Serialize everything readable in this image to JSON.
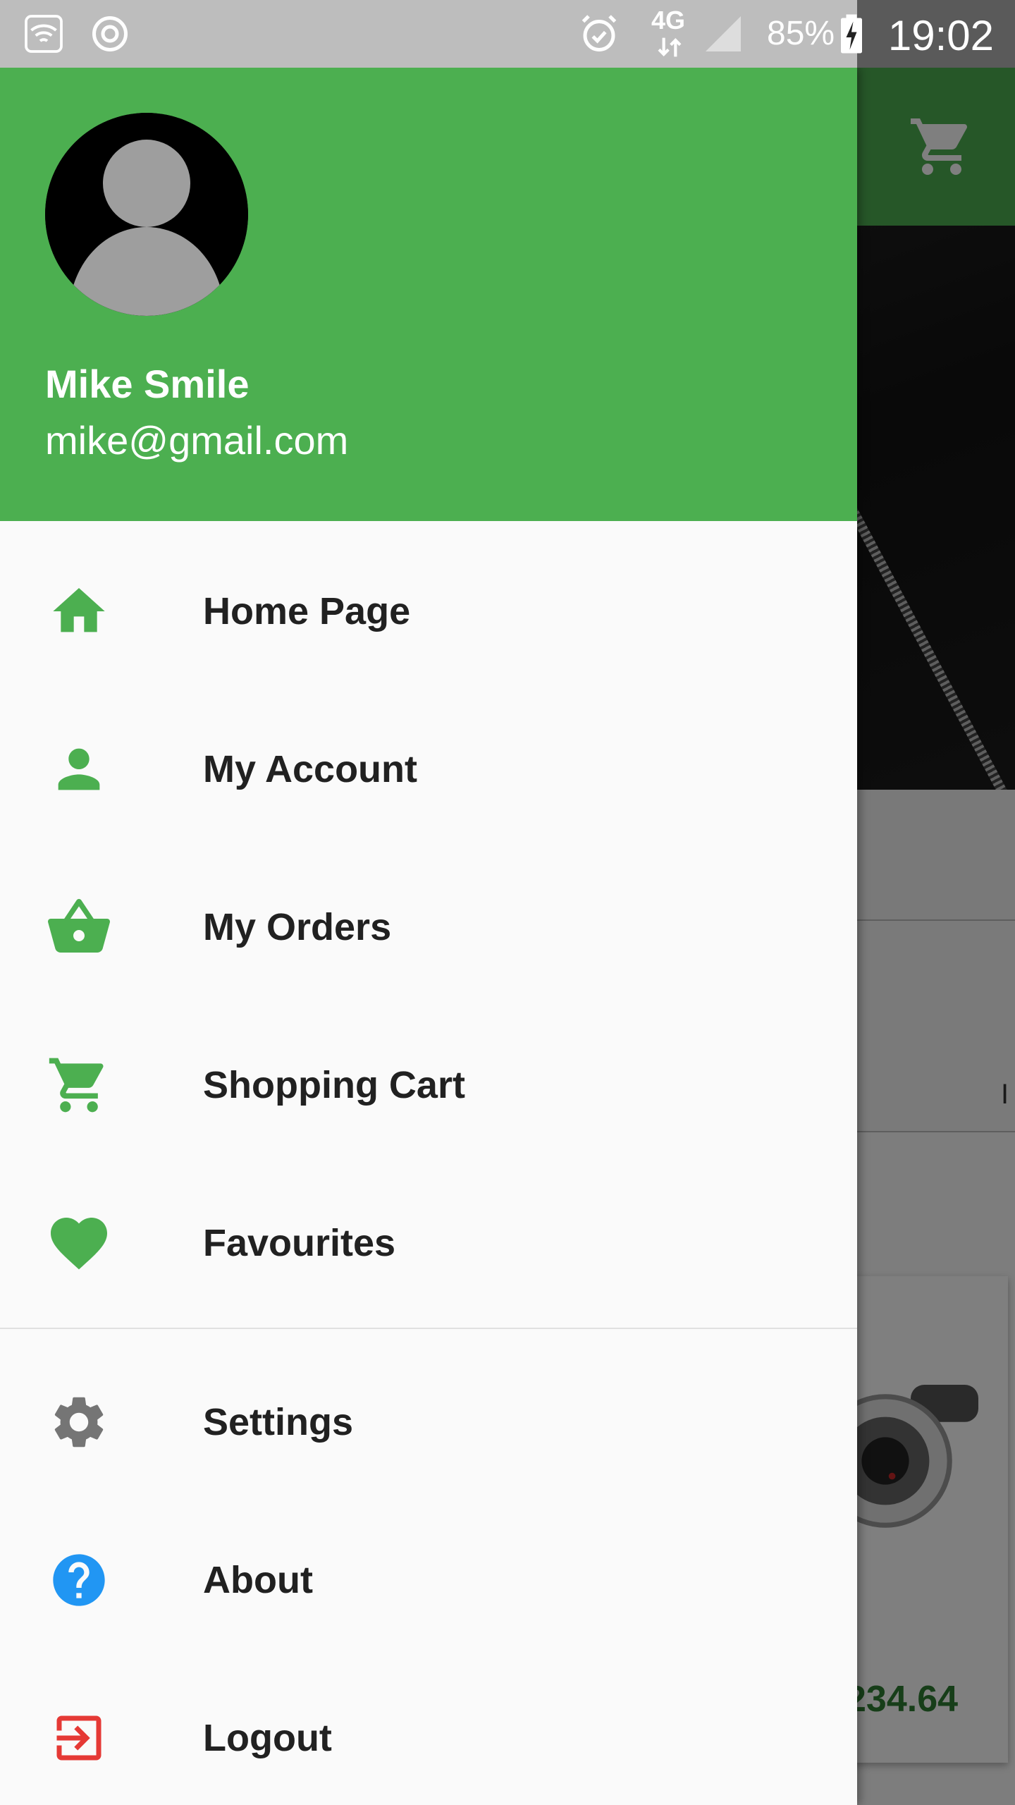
{
  "status_bar": {
    "battery": "85%",
    "network": "4G",
    "time": "19:02",
    "icons": [
      "wifi-icon",
      "sync-icon",
      "alarm-icon",
      "network-4g-icon",
      "signal-icon",
      "battery-charging-icon"
    ]
  },
  "background_app": {
    "price": "234.64",
    "row_text": "I",
    "toolbar_icon": "cart-icon"
  },
  "drawer": {
    "header": {
      "name": "Mike Smile",
      "email": "mike@gmail.com",
      "avatar_icon": "avatar-placeholder-icon"
    },
    "primary_items": [
      {
        "label": "Home Page",
        "icon": "home-icon"
      },
      {
        "label": "My Account",
        "icon": "person-icon"
      },
      {
        "label": "My Orders",
        "icon": "basket-icon"
      },
      {
        "label": "Shopping Cart",
        "icon": "cart-icon"
      },
      {
        "label": "Favourites",
        "icon": "heart-icon"
      }
    ],
    "secondary_items": [
      {
        "label": "Settings",
        "icon": "gear-icon"
      },
      {
        "label": "About",
        "icon": "help-icon"
      },
      {
        "label": "Logout",
        "icon": "logout-icon"
      }
    ]
  },
  "colors": {
    "primary": "#4caf50",
    "primary_dark": "#2e7d32",
    "icon_gray": "#757575",
    "about_blue": "#2196f3",
    "logout_red": "#e53935",
    "text": "#212121"
  }
}
